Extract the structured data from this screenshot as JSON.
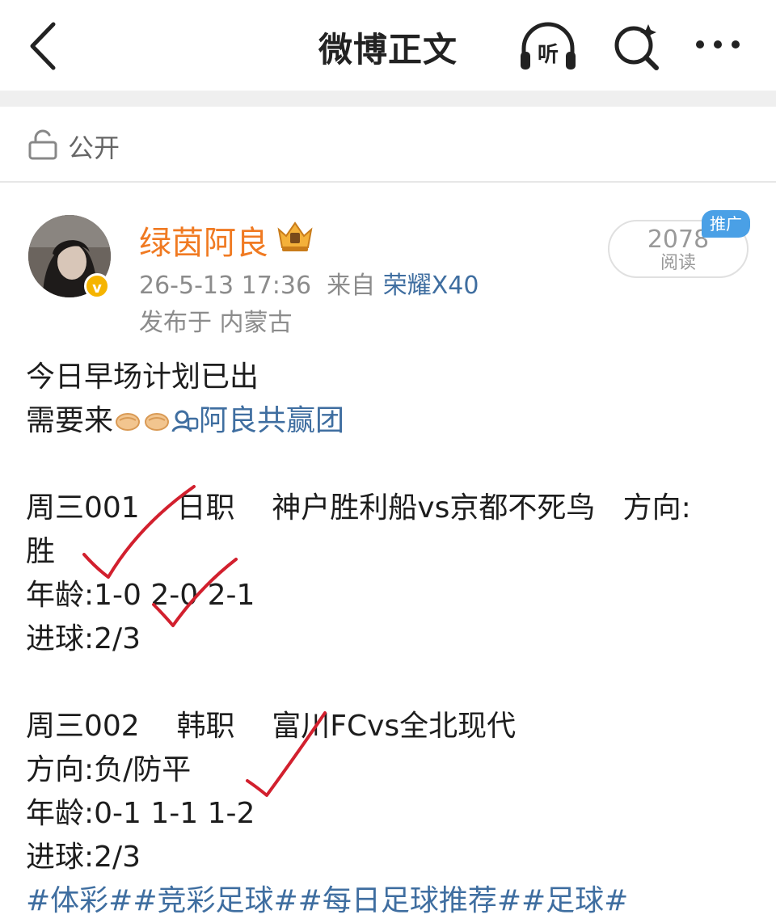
{
  "header": {
    "title": "微博正文",
    "listen_label": "听",
    "icons": [
      "back-arrow-icon",
      "listen-headphones-icon",
      "search-icon",
      "more-icon"
    ]
  },
  "privacy": {
    "icon": "lock-icon",
    "label": "公开"
  },
  "post": {
    "author": "绿茵阿良",
    "verified_badge": "v",
    "timestamp": "26-5-13 17:36",
    "source_prefix": "来自",
    "device": "荣耀X40",
    "location": "发布于 内蒙古",
    "reads": {
      "count": "2078",
      "label": "阅读"
    },
    "promo_tag": "推广",
    "content": {
      "line1": "今日早场计划已出",
      "line2_prefix": "需要来",
      "line2_mention": "阿良共赢团",
      "m1_header": "周三001    日职    神户胜利船vs京都不死鸟   方向:",
      "m1_direction": "胜",
      "m1_age": "年龄:1-0 2-0 2-1",
      "m1_goals": "进球:2/3",
      "m2_header": "周三002    韩职    富川FCvs全北现代",
      "m2_direction": "方向:负/防平",
      "m2_age": "年龄:0-1 1-1 1-2",
      "m2_goals": "进球:2/3",
      "hashtags": "#体彩##竞彩足球##每日足球推荐##足球#"
    }
  },
  "colors": {
    "accent_orange": "#f07a22",
    "link_blue": "#3f6ea0",
    "check_red": "#d2202e",
    "promo_blue": "#4aa0e6"
  }
}
